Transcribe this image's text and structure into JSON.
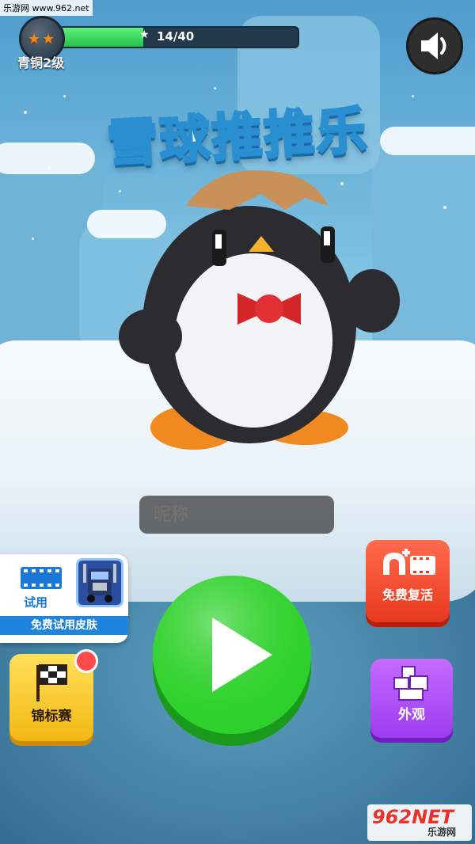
{
  "watermark": {
    "top": "乐游网 www.962.net",
    "bottom_big": "962NET",
    "bottom_small": "乐游网"
  },
  "player": {
    "rank": "青铜2级",
    "stars": 2,
    "xp_text": "14/40",
    "xp_fraction": 0.35
  },
  "game": {
    "title": "雪球推推乐"
  },
  "nickname": {
    "placeholder": "昵称"
  },
  "trial": {
    "label_top": "试用",
    "label_bottom": "免费试用皮肤"
  },
  "buttons": {
    "championship": "锦标赛",
    "revive": "免费复活",
    "skins": "外观"
  },
  "colors": {
    "play": "#2ed12b",
    "revive": "#e8391f",
    "skin": "#9b3cf0",
    "champ": "#f2b714"
  },
  "icons": [
    "sound-icon",
    "star-icon",
    "play-icon",
    "film-icon",
    "flag-icon",
    "blocks-icon"
  ]
}
